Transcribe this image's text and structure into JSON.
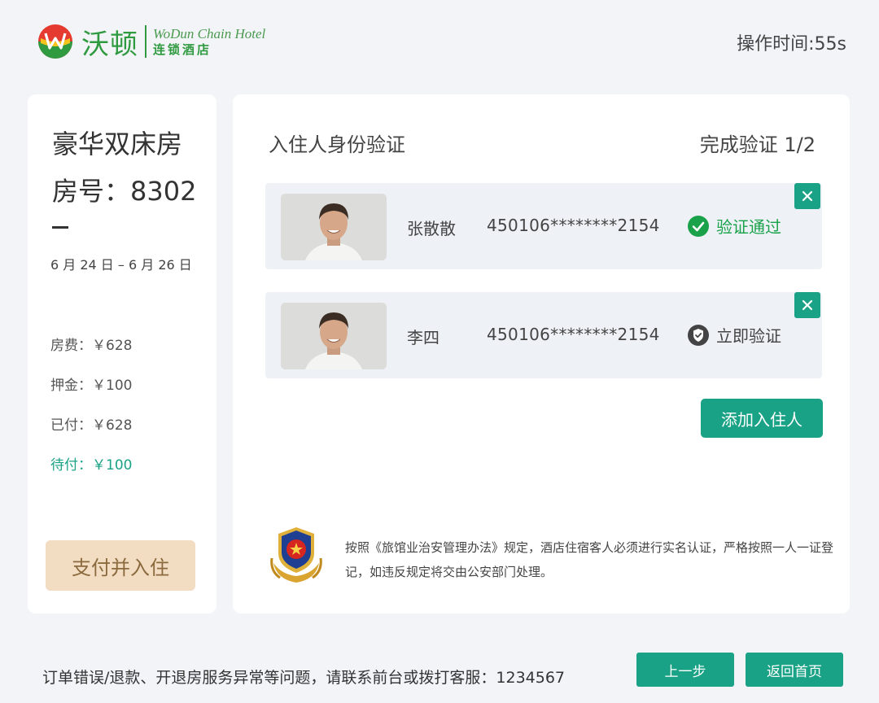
{
  "header": {
    "brand_cn": "沃顿",
    "brand_en": "WoDun Chain Hotel",
    "brand_sub": "连锁酒店",
    "operation_time": "操作时间:55s"
  },
  "room": {
    "type": "豪华双床房",
    "number": "房号：8302",
    "dates": "6 月 24 日 – 6 月 26 日",
    "fees": {
      "room_fee": "房费：￥628",
      "deposit": "押金：￥100",
      "paid": "已付：￥628",
      "due": "待付：￥100"
    },
    "pay_button": "支付并入住"
  },
  "verification": {
    "title": "入住人身份验证",
    "progress": "完成验证 1/2",
    "guests": [
      {
        "name": "张散散",
        "id_number": "450106********2154",
        "status": "验证通过",
        "status_icon": "check-circle-icon"
      },
      {
        "name": "李四",
        "id_number": "450106********2154",
        "status": "立即验证",
        "status_icon": "shield-icon"
      }
    ],
    "add_button": "添加入住人",
    "notice": "按照《旅馆业治安管理办法》规定，酒店住宿客人必须进行实名认证，严格按照一人一证登记，如违反规定将交由公安部门处理。"
  },
  "footer": {
    "help_text": "订单错误/退款、开退房服务异常等问题，请联系前台或拨打客服：1234567",
    "prev_button": "上一步",
    "home_button": "返回首页"
  },
  "colors": {
    "accent": "#1aa286",
    "success": "#19a249",
    "pay_button_bg": "#f2dcc2",
    "brand_green": "#2f9a3f"
  }
}
